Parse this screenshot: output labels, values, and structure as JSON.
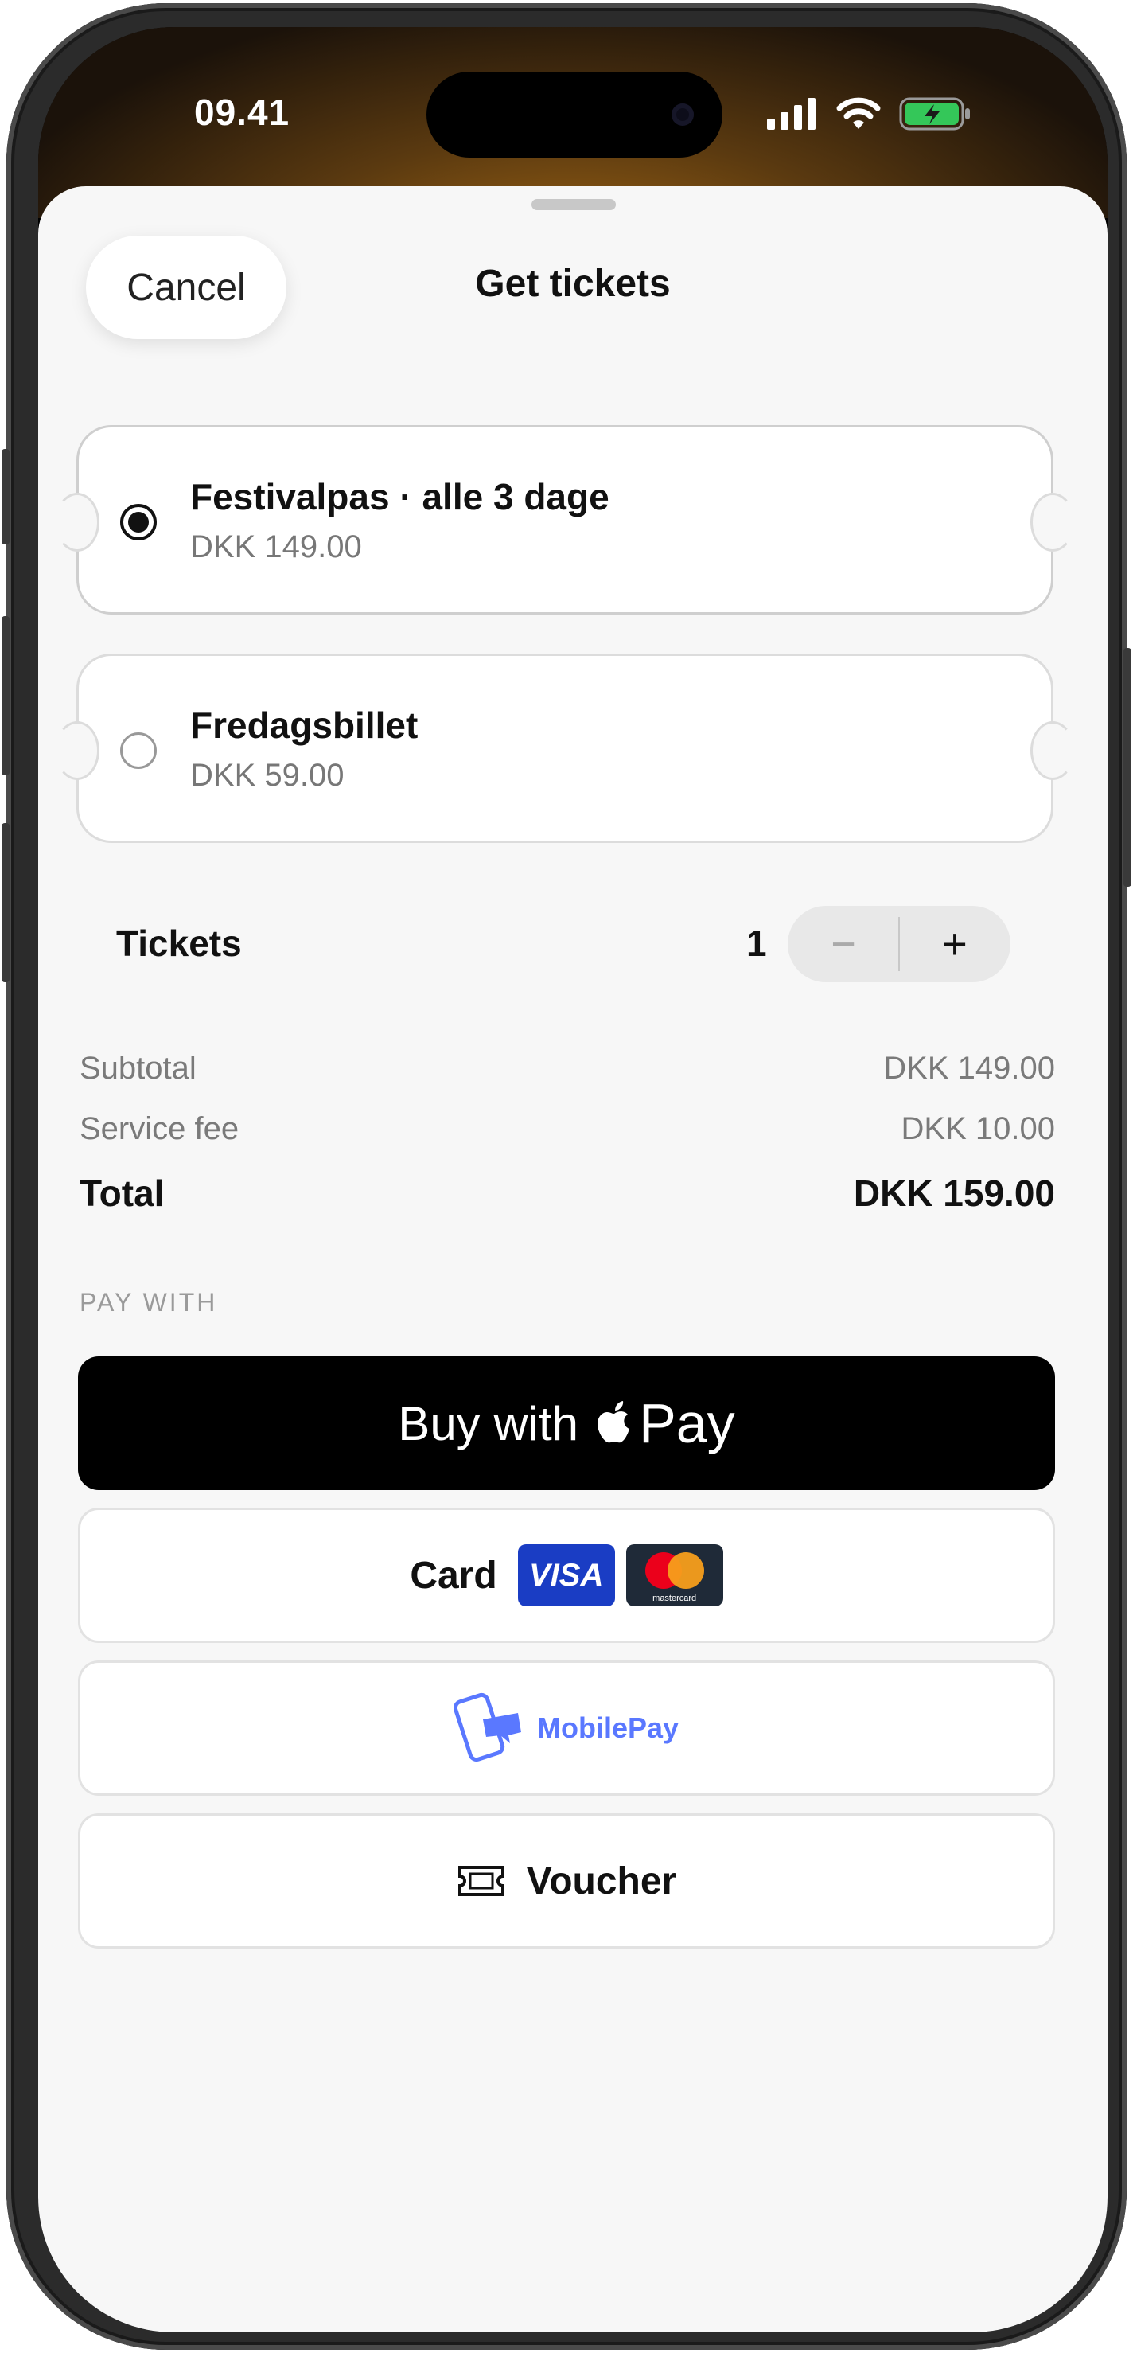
{
  "status_bar": {
    "time": "09.41"
  },
  "sheet": {
    "cancel_label": "Cancel",
    "title": "Get tickets"
  },
  "ticket_options": [
    {
      "name": "Festivalpas · alle 3 dage",
      "price": "DKK 149.00",
      "selected": true
    },
    {
      "name": "Fredagsbillet",
      "price": "DKK 59.00",
      "selected": false
    }
  ],
  "quantity": {
    "label": "Tickets",
    "value": "1",
    "minus": "−",
    "plus": "+"
  },
  "summary": {
    "subtotal_label": "Subtotal",
    "subtotal_value": "DKK 149.00",
    "fee_label": "Service fee",
    "fee_value": "DKK 10.00",
    "total_label": "Total",
    "total_value": "DKK 159.00"
  },
  "payment": {
    "section_label": "PAY WITH",
    "apple_pay_prefix": "Buy with",
    "apple_pay_word": "Pay",
    "card_label": "Card",
    "visa_text": "VISA",
    "mastercard_text": "mastercard",
    "mobilepay_label": "MobilePay",
    "voucher_label": "Voucher"
  },
  "colors": {
    "accent_mobilepay": "#5a78ff",
    "visa_blue": "#1a3dc4",
    "battery_green": "#34c759"
  }
}
